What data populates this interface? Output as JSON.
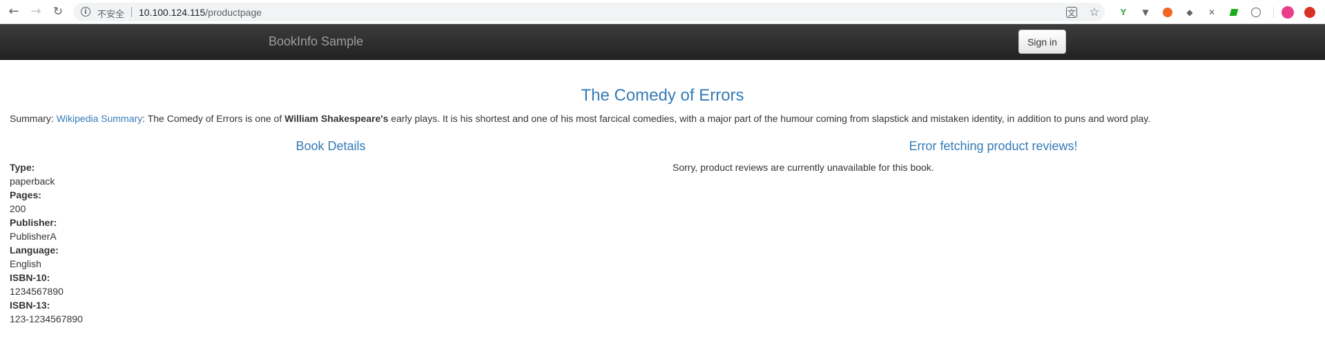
{
  "browser": {
    "security_label": "不安全",
    "url_host": "10.100.124.115",
    "url_path": "/productpage"
  },
  "navbar": {
    "brand": "BookInfo Sample",
    "signin_label": "Sign in"
  },
  "product": {
    "title": "The Comedy of Errors",
    "summary_prefix": "Summary: ",
    "summary_link": "Wikipedia Summary",
    "summary_mid": ": The Comedy of Errors is one of ",
    "summary_bold": "William Shakespeare's",
    "summary_rest": " early plays. It is his shortest and one of his most farcical comedies, with a major part of the humour coming from slapstick and mistaken identity, in addition to puns and word play."
  },
  "details": {
    "heading": "Book Details",
    "fields": [
      {
        "label": "Type:",
        "value": "paperback"
      },
      {
        "label": "Pages:",
        "value": "200"
      },
      {
        "label": "Publisher:",
        "value": "PublisherA"
      },
      {
        "label": "Language:",
        "value": "English"
      },
      {
        "label": "ISBN-10:",
        "value": "1234567890"
      },
      {
        "label": "ISBN-13:",
        "value": "123-1234567890"
      }
    ]
  },
  "reviews": {
    "heading": "Error fetching product reviews!",
    "message": "Sorry, product reviews are currently unavailable for this book."
  },
  "icons": {
    "back": "arrow-left-icon",
    "forward": "arrow-right-icon",
    "reload": "reload-icon",
    "info": "info-icon",
    "translate": "translate-icon",
    "bookmark": "star-icon"
  },
  "colors": {
    "link": "#337ab7",
    "navbar": "#222222",
    "brand": "#9d9d9d",
    "text": "#333333"
  }
}
